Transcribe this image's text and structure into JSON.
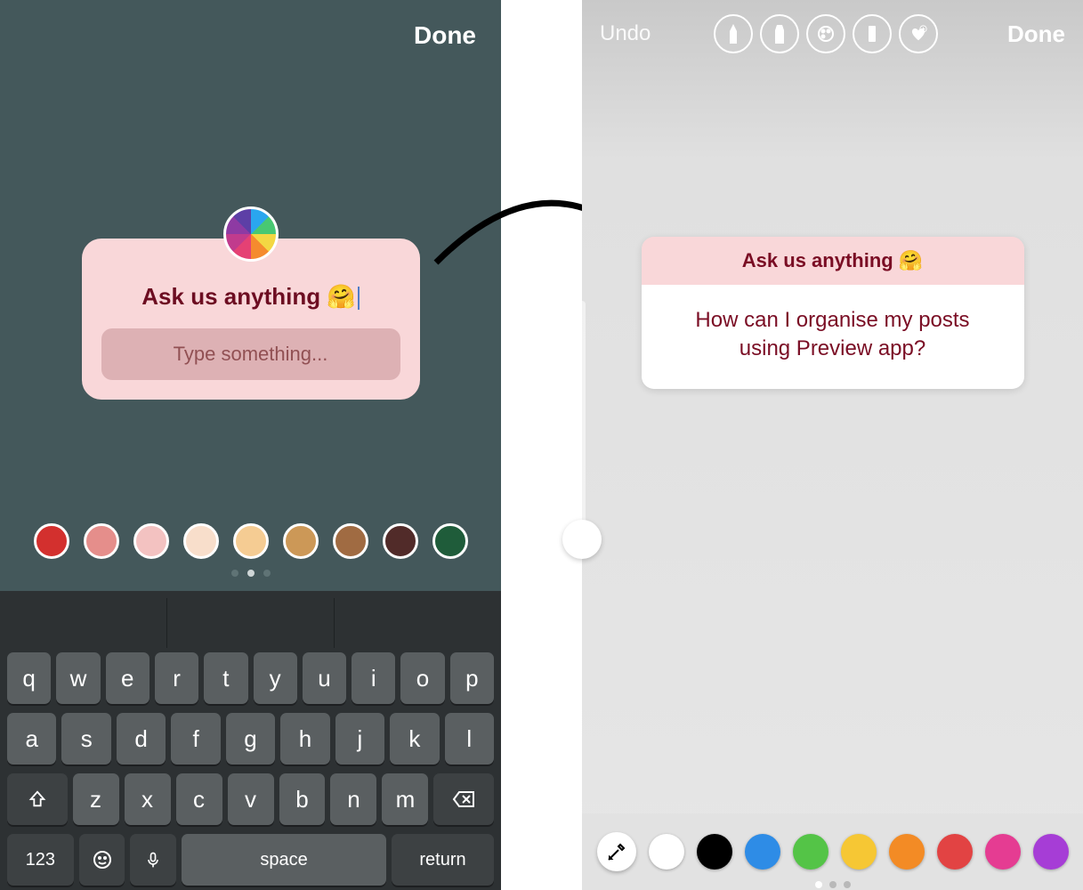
{
  "left": {
    "header": {
      "done": "Done"
    },
    "question": {
      "prompt": "Ask us anything 🤗",
      "placeholder": "Type something..."
    },
    "swatches": [
      "#d3302e",
      "#e58e8b",
      "#f3c2c1",
      "#f8decb",
      "#f5cc93",
      "#cc9857",
      "#a06b42",
      "#512b29",
      "#1f5c3a"
    ],
    "keyboard": {
      "row1": [
        "q",
        "w",
        "e",
        "r",
        "t",
        "y",
        "u",
        "i",
        "o",
        "p"
      ],
      "row2": [
        "a",
        "s",
        "d",
        "f",
        "g",
        "h",
        "j",
        "k",
        "l"
      ],
      "row3": [
        "z",
        "x",
        "c",
        "v",
        "b",
        "n",
        "m"
      ],
      "numeric": "123",
      "space": "space",
      "return": "return"
    }
  },
  "right": {
    "header": {
      "undo": "Undo",
      "done": "Done"
    },
    "tools": [
      "pen",
      "marker",
      "palette",
      "eraser",
      "heart"
    ],
    "question": {
      "prompt": "Ask us anything 🤗",
      "answer": "How can I organise my posts using Preview app?"
    },
    "swatches": [
      "#ffffff",
      "#000000",
      "#2e8ce6",
      "#54c447",
      "#f6c734",
      "#f38b25",
      "#e24343",
      "#e53c92",
      "#a63dd6"
    ]
  }
}
